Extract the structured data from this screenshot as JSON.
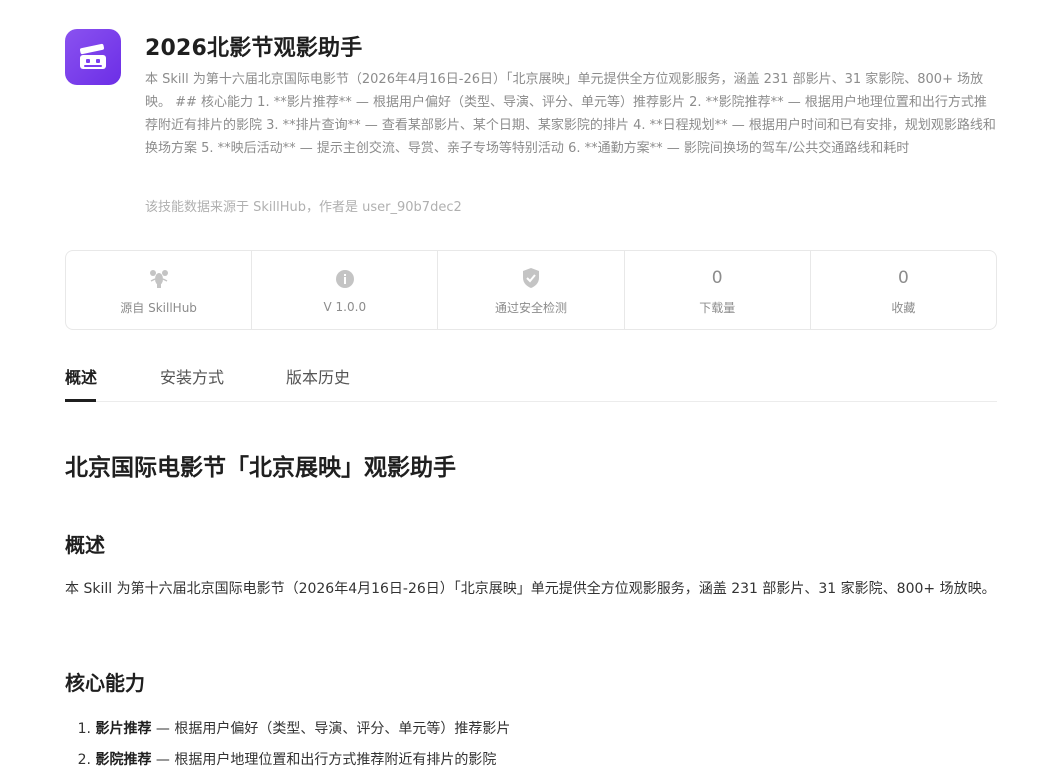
{
  "header": {
    "title": "2026北影节观影助手",
    "description": "本 Skill 为第十六届北京国际电影节（2026年4月16日-26日）「北京展映」单元提供全方位观影服务，涵盖 231 部影片、31 家影院、800+ 场放映。 ## 核心能力 1. **影片推荐** — 根据用户偏好（类型、导演、评分、单元等）推荐影片 2. **影院推荐** — 根据用户地理位置和出行方式推荐附近有排片的影院 3. **排片查询** — 查看某部影片、某个日期、某家影院的排片 4. **日程规划** — 根据用户时间和已有安排，规划观影路线和换场方案 5. **映后活动** — 提示主创交流、导赏、亲子专场等特别活动 6. **通勤方案** — 影院间换场的驾车/公共交通路线和耗时",
    "source_note": "该技能数据来源于 SkillHub，作者是 user_90b7dec2",
    "icon_color": "#7b3ff0"
  },
  "stats": [
    {
      "icon": "lobster-icon",
      "value": "",
      "label": "源自 SkillHub"
    },
    {
      "icon": "info-icon",
      "value": "",
      "label": "V 1.0.0"
    },
    {
      "icon": "shield-check-icon",
      "value": "",
      "label": "通过安全检测"
    },
    {
      "icon": "",
      "value": "0",
      "label": "下载量"
    },
    {
      "icon": "",
      "value": "0",
      "label": "收藏"
    }
  ],
  "tabs": [
    {
      "label": "概述",
      "active": true
    },
    {
      "label": "安装方式",
      "active": false
    },
    {
      "label": "版本历史",
      "active": false
    }
  ],
  "content": {
    "h1": "北京国际电影节「北京展映」观影助手",
    "overview_heading": "概述",
    "overview_text": "本 Skill 为第十六届北京国际电影节（2026年4月16日-26日）「北京展映」单元提供全方位观影服务，涵盖 231 部影片、31 家影院、800+ 场放映。",
    "capabilities_heading": "核心能力",
    "capabilities": [
      {
        "num": "1.",
        "name": "影片推荐",
        "text": " — 根据用户偏好（类型、导演、评分、单元等）推荐影片"
      },
      {
        "num": "2.",
        "name": "影院推荐",
        "text": " — 根据用户地理位置和出行方式推荐附近有排片的影院"
      }
    ]
  }
}
